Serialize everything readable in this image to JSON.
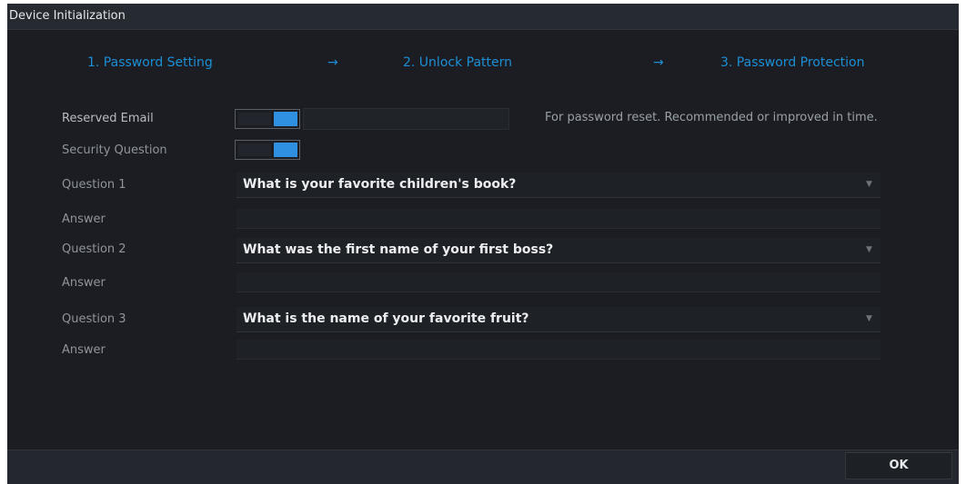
{
  "window": {
    "title": "Device Initialization"
  },
  "steps": [
    {
      "label": "1.  Password Setting"
    },
    {
      "label": "2.  Unlock Pattern"
    },
    {
      "label": "3.  Password Protection"
    }
  ],
  "step_arrow": "→",
  "form": {
    "reserved_email_label": "Reserved Email",
    "reserved_email_on": true,
    "security_question_label": "Security Question",
    "security_question_on": true,
    "hint": "For password reset. Recommended or improved in time.",
    "questions": [
      {
        "label": "Question 1",
        "value": "What is your favorite children's book?",
        "answer_label": "Answer",
        "answer": ""
      },
      {
        "label": "Question 2",
        "value": "What was the first name of your first boss?",
        "answer_label": "Answer",
        "answer": ""
      },
      {
        "label": "Question 3",
        "value": "What is the name of your favorite fruit?",
        "answer_label": "Answer",
        "answer": ""
      }
    ]
  },
  "footer": {
    "ok_label": "OK"
  },
  "colors": {
    "accent": "#2f8fe0",
    "step_text": "#1c8fd6",
    "background": "#1b1d22"
  }
}
